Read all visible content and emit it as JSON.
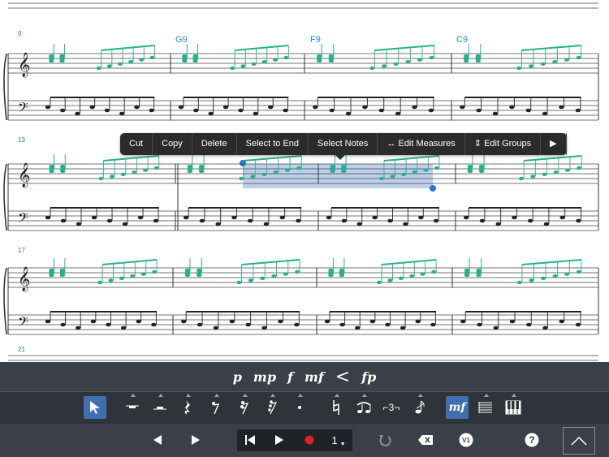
{
  "score": {
    "measure_numbers": [
      "9",
      "13",
      "17",
      "21"
    ],
    "chords": [
      "G9",
      "F9",
      "C9"
    ]
  },
  "context_menu": {
    "items": [
      "Cut",
      "Copy",
      "Delete",
      "Select to End",
      "Select Notes",
      "↔ Edit Measures",
      "⇕ Edit Groups",
      "▶"
    ]
  },
  "dynamics": [
    "p",
    "mp",
    "f",
    "mf",
    "<",
    "fp"
  ],
  "note_toolbar": {
    "tuplet_label": "⌐3¬",
    "dynamic_label": "mf"
  },
  "transport": {
    "count_value": "1",
    "help_label": "?",
    "voice_label": "V1",
    "record_color": "#e02020"
  },
  "colors": {
    "note_green": "#23b38a",
    "selection": "#9fb7de",
    "handle": "#2a72d9",
    "active": "#3f6fb0"
  }
}
